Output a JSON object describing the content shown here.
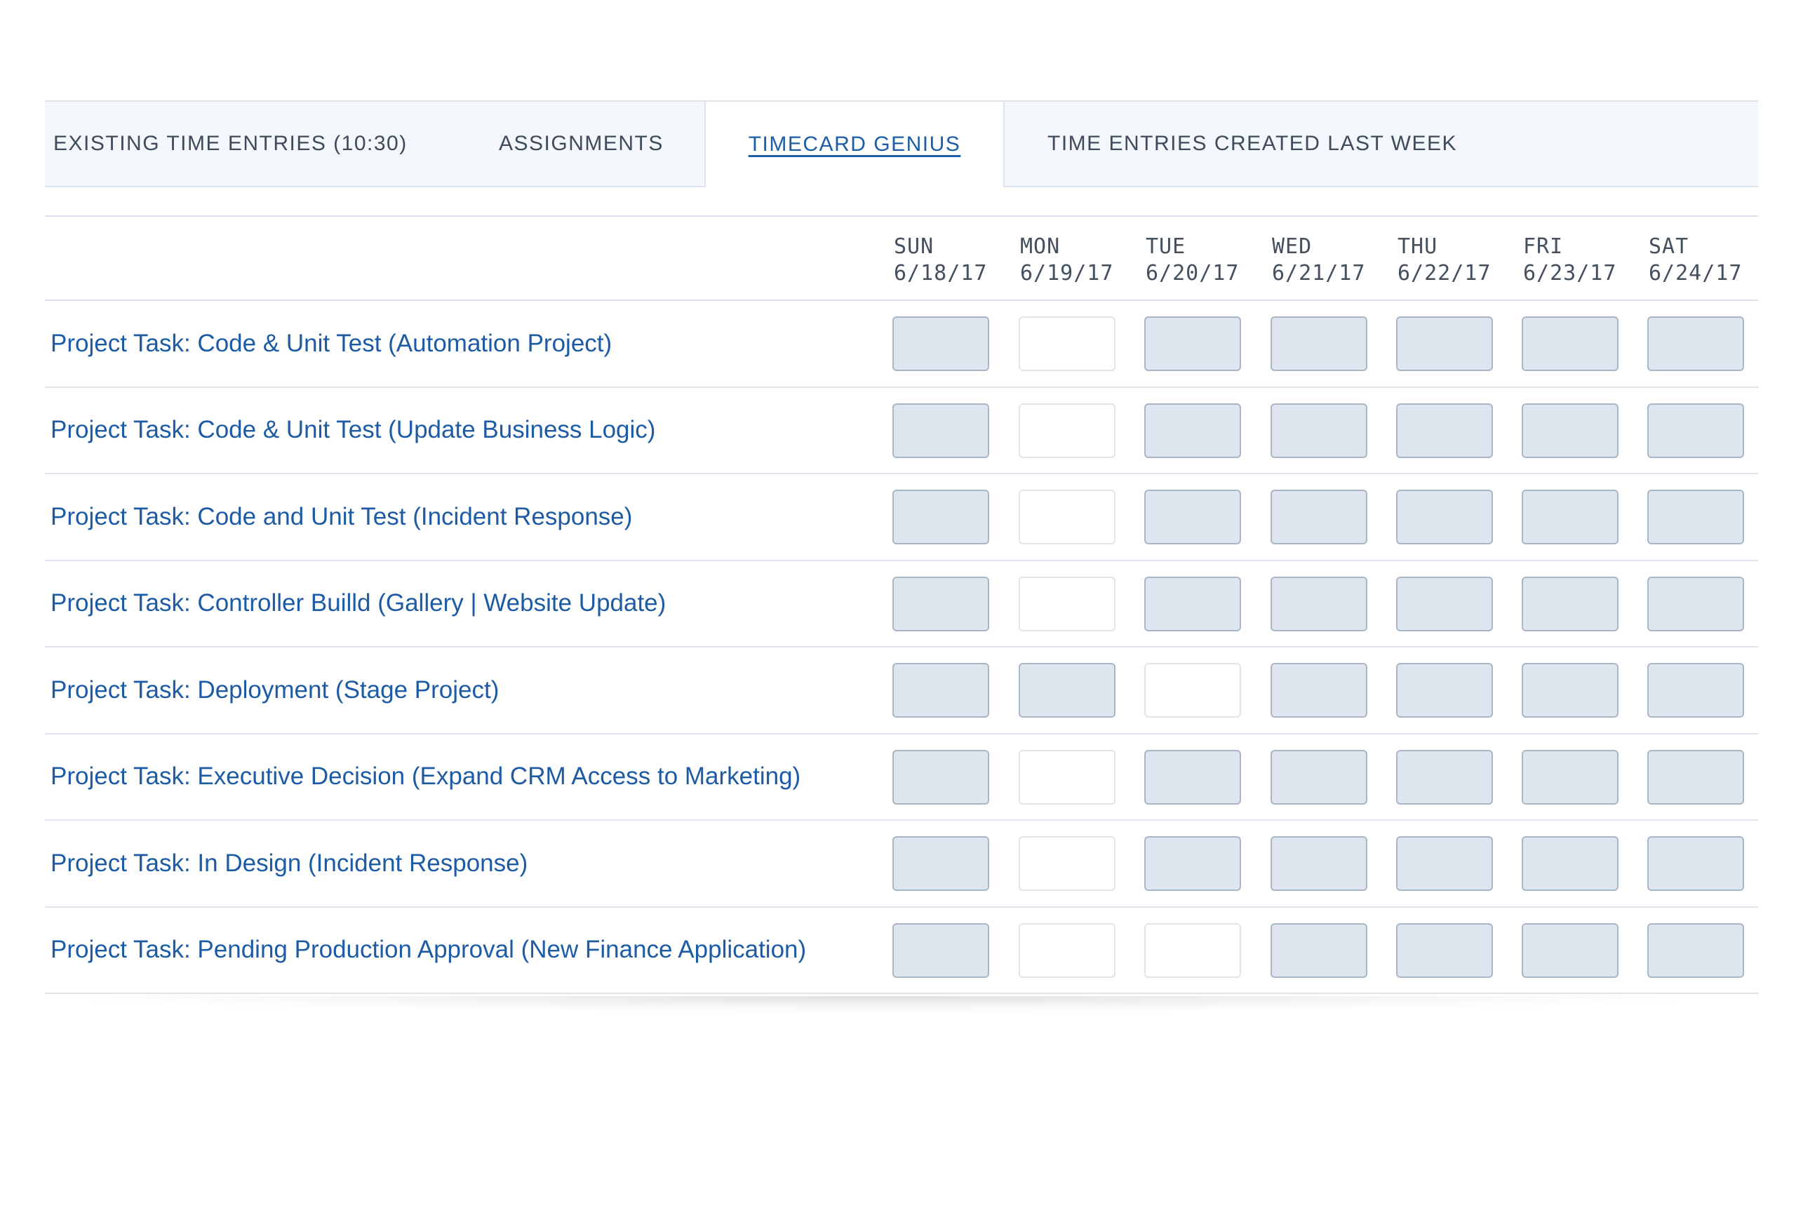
{
  "tabs": [
    {
      "label": "EXISTING TIME ENTRIES (10:30)",
      "active": false
    },
    {
      "label": "ASSIGNMENTS",
      "active": false
    },
    {
      "label": "TIMECARD GENIUS",
      "active": true
    },
    {
      "label": "TIME ENTRIES CREATED LAST WEEK",
      "active": false
    }
  ],
  "days": [
    {
      "name": "SUN",
      "date": "6/18/17"
    },
    {
      "name": "MON",
      "date": "6/19/17"
    },
    {
      "name": "TUE",
      "date": "6/20/17"
    },
    {
      "name": "WED",
      "date": "6/21/17"
    },
    {
      "name": "THU",
      "date": "6/22/17"
    },
    {
      "name": "FRI",
      "date": "6/23/17"
    },
    {
      "name": "SAT",
      "date": "6/24/17"
    }
  ],
  "rows": [
    {
      "task": "Project Task: Code & Unit Test (Automation Project)",
      "editable": [
        false,
        true,
        false,
        false,
        false,
        false,
        false
      ]
    },
    {
      "task": "Project Task: Code & Unit Test (Update Business Logic)",
      "editable": [
        false,
        true,
        false,
        false,
        false,
        false,
        false
      ]
    },
    {
      "task": "Project Task: Code and Unit Test (Incident Response)",
      "editable": [
        false,
        true,
        false,
        false,
        false,
        false,
        false
      ]
    },
    {
      "task": "Project Task: Controller Builld (Gallery | Website Update)",
      "editable": [
        false,
        true,
        false,
        false,
        false,
        false,
        false
      ]
    },
    {
      "task": "Project Task: Deployment (Stage Project)",
      "editable": [
        false,
        false,
        true,
        false,
        false,
        false,
        false
      ]
    },
    {
      "task": "Project Task: Executive Decision (Expand CRM Access to Marketing)",
      "editable": [
        false,
        true,
        false,
        false,
        false,
        false,
        false
      ]
    },
    {
      "task": "Project Task: In Design (Incident Response)",
      "editable": [
        false,
        true,
        false,
        false,
        false,
        false,
        false
      ]
    },
    {
      "task": "Project Task: Pending Production Approval (New Finance Application)",
      "editable": [
        false,
        true,
        true,
        false,
        false,
        false,
        false
      ]
    }
  ],
  "colors": {
    "accent": "#1d5ba4",
    "tab_bg": "#f3f6fa",
    "cell_filled": "#dfe5ef",
    "cell_empty": "#ffffff",
    "border": "#dde3ec"
  }
}
